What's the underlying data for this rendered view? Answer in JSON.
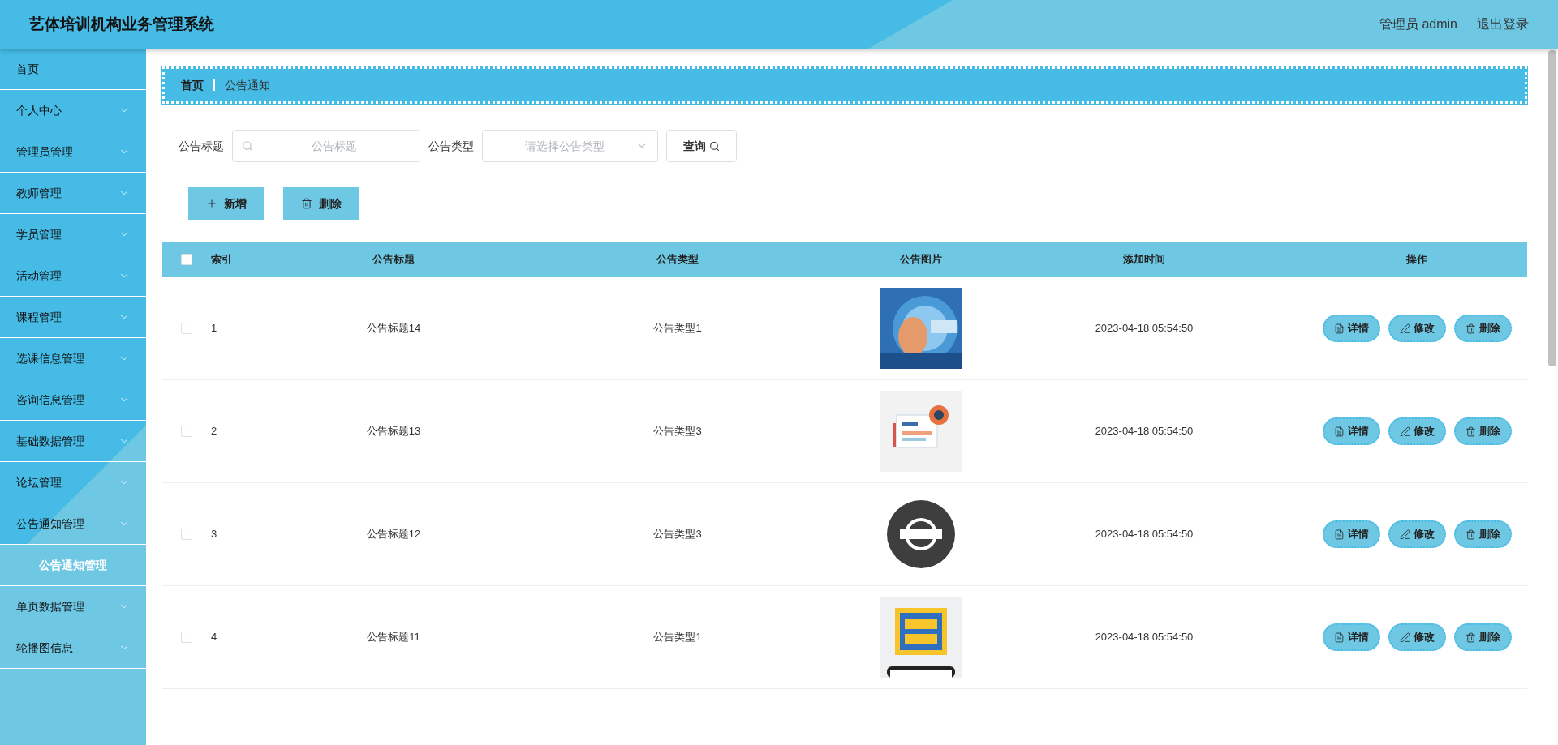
{
  "header": {
    "title": "艺体培训机构业务管理系统",
    "user": "管理员 admin",
    "logout": "退出登录"
  },
  "sidebar": {
    "items": [
      {
        "label": "首页",
        "kind": "link"
      },
      {
        "label": "个人中心",
        "kind": "menu"
      },
      {
        "label": "管理员管理",
        "kind": "menu"
      },
      {
        "label": "教师管理",
        "kind": "menu"
      },
      {
        "label": "学员管理",
        "kind": "menu"
      },
      {
        "label": "活动管理",
        "kind": "menu"
      },
      {
        "label": "课程管理",
        "kind": "menu"
      },
      {
        "label": "选课信息管理",
        "kind": "menu"
      },
      {
        "label": "咨询信息管理",
        "kind": "menu"
      },
      {
        "label": "基础数据管理",
        "kind": "menu"
      },
      {
        "label": "论坛管理",
        "kind": "menu"
      },
      {
        "label": "公告通知管理",
        "kind": "menu",
        "children": [
          {
            "label": "公告通知管理",
            "selected": true
          }
        ]
      },
      {
        "label": "单页数据管理",
        "kind": "menu"
      },
      {
        "label": "轮播图信息",
        "kind": "menu"
      }
    ]
  },
  "breadcrumb": [
    "首页",
    "公告通知"
  ],
  "search": {
    "title_label": "公告标题",
    "title_placeholder": "公告标题",
    "type_label": "公告类型",
    "type_placeholder": "请选择公告类型",
    "query_button": "查询"
  },
  "actions": {
    "add": "新增",
    "delete": "删除"
  },
  "table": {
    "select_all_checked": false,
    "columns": [
      "索引",
      "公告标题",
      "公告类型",
      "公告图片",
      "添加时间",
      "操作"
    ],
    "rows": [
      {
        "checked": false,
        "index": "1",
        "title": "公告标题14",
        "type": "公告类型1",
        "picture": {
          "kind": "picture"
        },
        "time": "2023-04-18 05:54:50",
        "buttons": [
          "详情",
          "修改",
          "删除"
        ]
      },
      {
        "checked": false,
        "index": "2",
        "title": "公告标题13",
        "type": "公告类型3",
        "picture": {
          "kind": "picture"
        },
        "time": "2023-04-18 05:54:50",
        "buttons": [
          "详情",
          "修改",
          "删除"
        ]
      },
      {
        "checked": false,
        "index": "3",
        "title": "公告标题12",
        "type": "公告类型3",
        "picture": {
          "kind": "picture"
        },
        "time": "2023-04-18 05:54:50",
        "buttons": [
          "详情",
          "修改",
          "删除"
        ]
      },
      {
        "checked": false,
        "index": "4",
        "title": "公告标题11",
        "type": "公告类型1",
        "picture": {
          "kind": "picture"
        },
        "time": "2023-04-18 05:54:50",
        "buttons": [
          "详情",
          "修改",
          "删除"
        ]
      }
    ]
  }
}
